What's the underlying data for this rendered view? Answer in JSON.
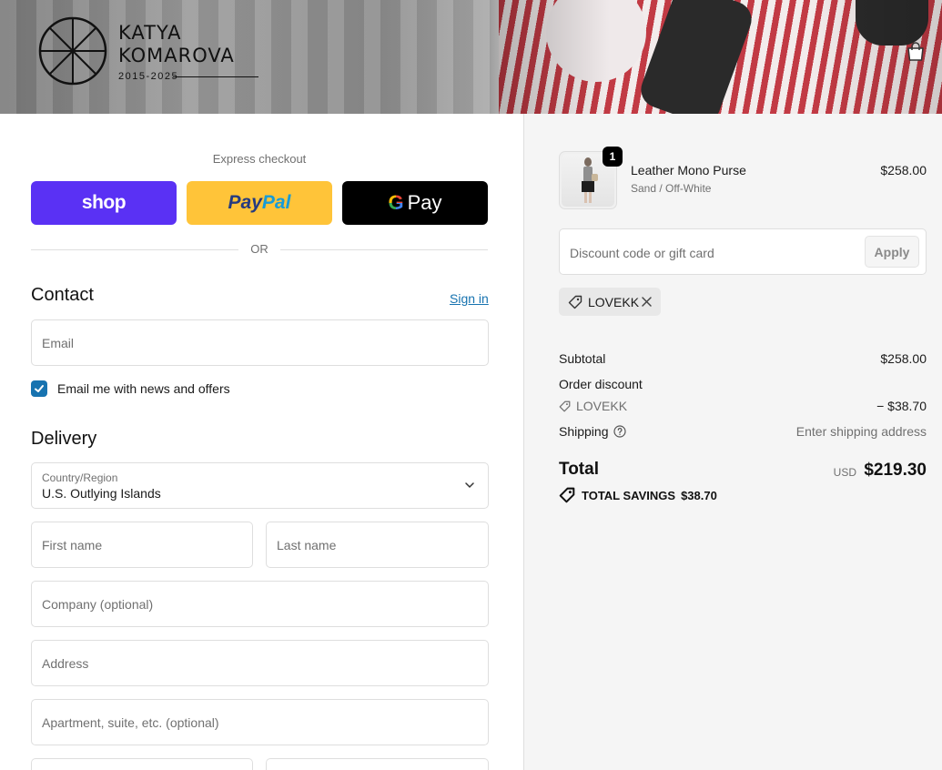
{
  "brand": {
    "name_line1": "KATYA",
    "name_line2": "KOMAROVA",
    "years": "2015-2025"
  },
  "express": {
    "title": "Express checkout",
    "shop_label": "shop",
    "paypal_label_1": "Pay",
    "paypal_label_2": "Pal",
    "gpay_g": "G",
    "gpay_label": "Pay",
    "divider": "OR"
  },
  "contact": {
    "title": "Contact",
    "signin": "Sign in",
    "email_placeholder": "Email",
    "newsletter_label": "Email me with news and offers",
    "newsletter_checked": true
  },
  "delivery": {
    "title": "Delivery",
    "country_label": "Country/Region",
    "country_value": "U.S. Outlying Islands",
    "first_name_placeholder": "First name",
    "last_name_placeholder": "Last name",
    "company_placeholder": "Company (optional)",
    "address_placeholder": "Address",
    "apartment_placeholder": "Apartment, suite, etc. (optional)"
  },
  "order": {
    "item": {
      "quantity": "1",
      "name": "Leather Mono Purse",
      "variant": "Sand / Off-White",
      "price": "$258.00"
    },
    "discount_placeholder": "Discount code or gift card",
    "apply_label": "Apply",
    "applied_code": "LOVEKK",
    "subtotal_label": "Subtotal",
    "subtotal_value": "$258.00",
    "order_discount_label": "Order discount",
    "discount_code": "LOVEKK",
    "discount_value": "− $38.70",
    "shipping_label": "Shipping",
    "shipping_value": "Enter shipping address",
    "total_label": "Total",
    "currency": "USD",
    "total_value": "$219.30",
    "savings_label": "TOTAL SAVINGS",
    "savings_value": "$38.70"
  },
  "colors": {
    "shop_purple": "#5a31f4",
    "paypal_yellow": "#ffc439",
    "link_blue": "#1773b0"
  }
}
